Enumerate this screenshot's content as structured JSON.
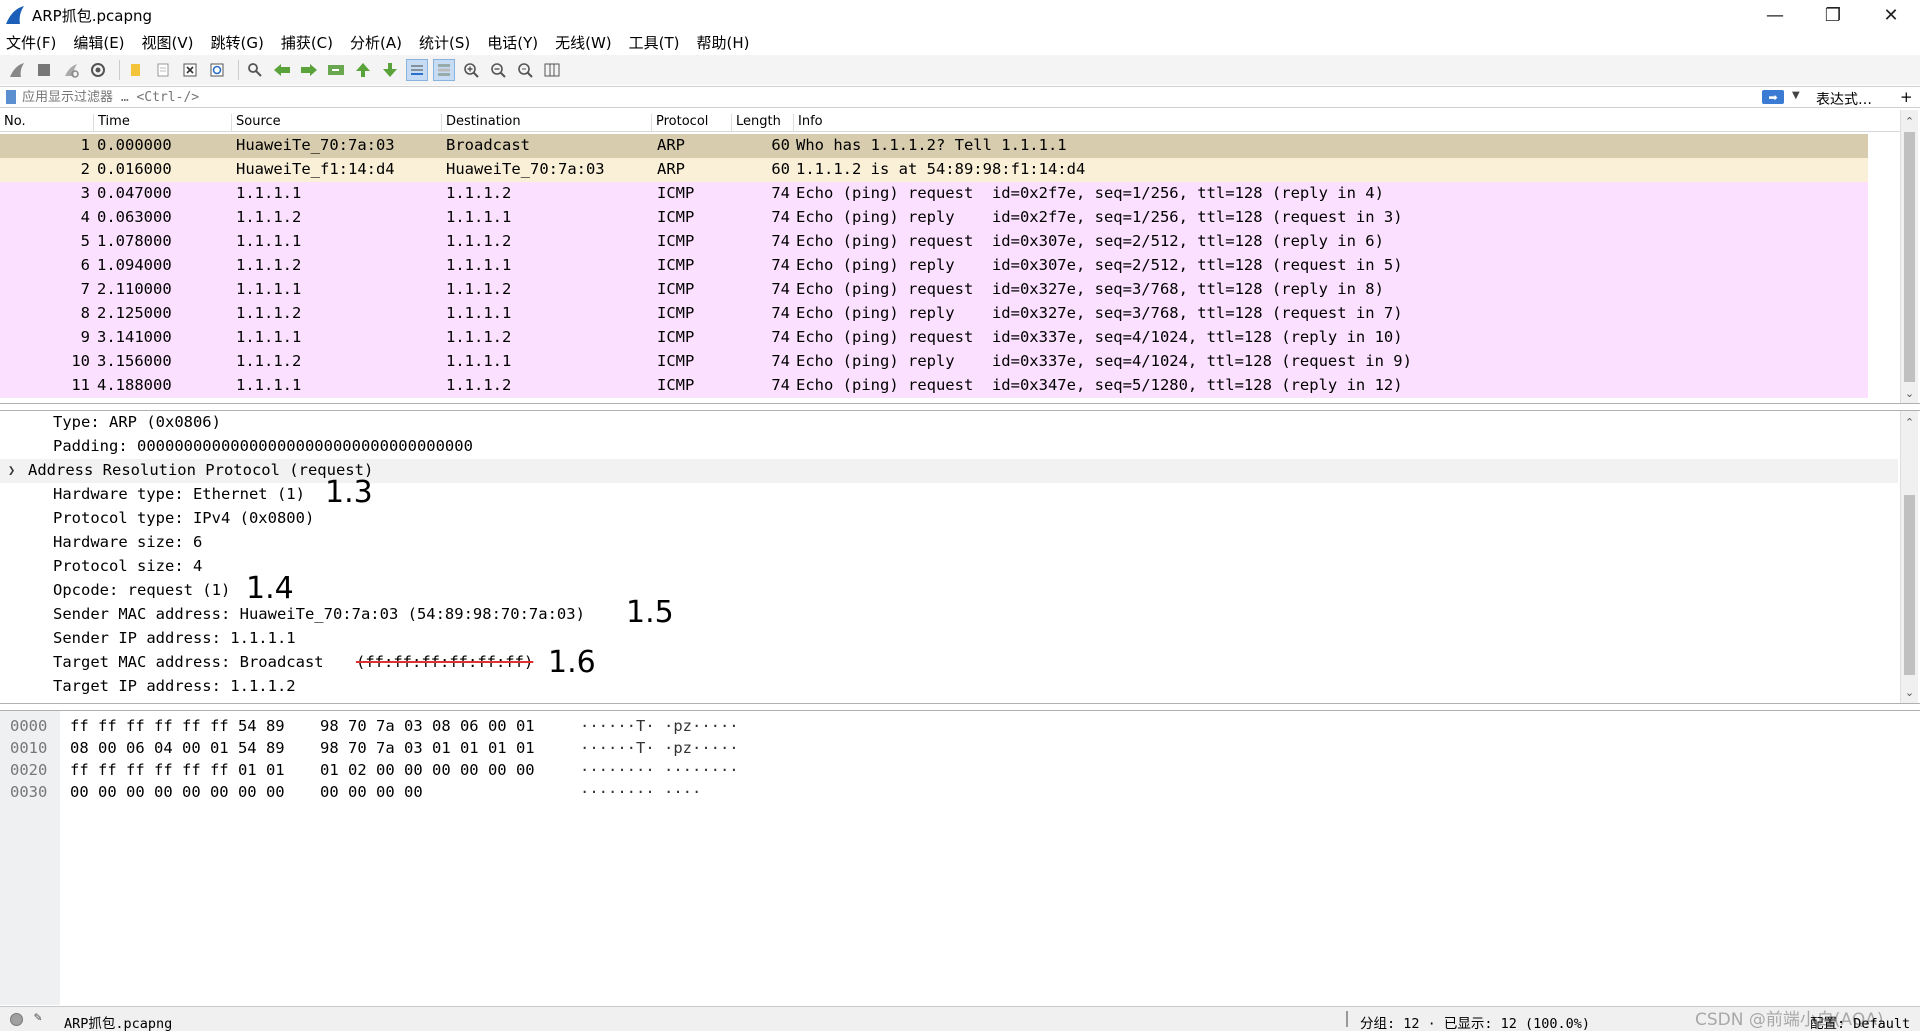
{
  "window": {
    "title": "ARP抓包.pcapng",
    "minimize": "—",
    "restore": "❐",
    "close": "✕"
  },
  "menu": [
    "文件(F)",
    "编辑(E)",
    "视图(V)",
    "跳转(G)",
    "捕获(C)",
    "分析(A)",
    "统计(S)",
    "电话(Y)",
    "无线(W)",
    "工具(T)",
    "帮助(H)"
  ],
  "toolbar": {
    "icons": [
      "shark-fin-start-icon",
      "stop-icon",
      "restart-icon",
      "options-gear-icon",
      "open-folder-icon",
      "save-file-icon",
      "close-file-icon",
      "reload-icon",
      "find-icon",
      "go-back-icon",
      "go-forward-icon",
      "go-to-packet-icon",
      "go-first-icon",
      "go-last-icon",
      "autoscroll-icon",
      "colorize-icon",
      "zoom-in-icon",
      "zoom-out-icon",
      "zoom-normal-icon",
      "resize-columns-icon"
    ]
  },
  "filter": {
    "placeholder": "应用显示过滤器 … <Ctrl-/>",
    "expression_label": "表达式…",
    "add_label": "+"
  },
  "packet_list": {
    "columns": [
      "No.",
      "Time",
      "Source",
      "Destination",
      "Protocol",
      "Length",
      "Info"
    ],
    "rows": [
      {
        "no": "1",
        "time": "0.000000",
        "src": "HuaweiTe_70:7a:03",
        "dst": "Broadcast",
        "proto": "ARP",
        "len": "60",
        "info": "Who has 1.1.1.2? Tell 1.1.1.1"
      },
      {
        "no": "2",
        "time": "0.016000",
        "src": "HuaweiTe_f1:14:d4",
        "dst": "HuaweiTe_70:7a:03",
        "proto": "ARP",
        "len": "60",
        "info": "1.1.1.2 is at 54:89:98:f1:14:d4"
      },
      {
        "no": "3",
        "time": "0.047000",
        "src": "1.1.1.1",
        "dst": "1.1.1.2",
        "proto": "ICMP",
        "len": "74",
        "info": "Echo (ping) request  id=0x2f7e, seq=1/256, ttl=128 (reply in 4)"
      },
      {
        "no": "4",
        "time": "0.063000",
        "src": "1.1.1.2",
        "dst": "1.1.1.1",
        "proto": "ICMP",
        "len": "74",
        "info": "Echo (ping) reply    id=0x2f7e, seq=1/256, ttl=128 (request in 3)"
      },
      {
        "no": "5",
        "time": "1.078000",
        "src": "1.1.1.1",
        "dst": "1.1.1.2",
        "proto": "ICMP",
        "len": "74",
        "info": "Echo (ping) request  id=0x307e, seq=2/512, ttl=128 (reply in 6)"
      },
      {
        "no": "6",
        "time": "1.094000",
        "src": "1.1.1.2",
        "dst": "1.1.1.1",
        "proto": "ICMP",
        "len": "74",
        "info": "Echo (ping) reply    id=0x307e, seq=2/512, ttl=128 (request in 5)"
      },
      {
        "no": "7",
        "time": "2.110000",
        "src": "1.1.1.1",
        "dst": "1.1.1.2",
        "proto": "ICMP",
        "len": "74",
        "info": "Echo (ping) request  id=0x327e, seq=3/768, ttl=128 (reply in 8)"
      },
      {
        "no": "8",
        "time": "2.125000",
        "src": "1.1.1.2",
        "dst": "1.1.1.1",
        "proto": "ICMP",
        "len": "74",
        "info": "Echo (ping) reply    id=0x327e, seq=3/768, ttl=128 (request in 7)"
      },
      {
        "no": "9",
        "time": "3.141000",
        "src": "1.1.1.1",
        "dst": "1.1.1.2",
        "proto": "ICMP",
        "len": "74",
        "info": "Echo (ping) request  id=0x337e, seq=4/1024, ttl=128 (reply in 10)"
      },
      {
        "no": "10",
        "time": "3.156000",
        "src": "1.1.1.2",
        "dst": "1.1.1.1",
        "proto": "ICMP",
        "len": "74",
        "info": "Echo (ping) reply    id=0x337e, seq=4/1024, ttl=128 (request in 9)"
      },
      {
        "no": "11",
        "time": "4.188000",
        "src": "1.1.1.1",
        "dst": "1.1.1.2",
        "proto": "ICMP",
        "len": "74",
        "info": "Echo (ping) request  id=0x347e, seq=5/1280, ttl=128 (reply in 12)"
      }
    ]
  },
  "details": {
    "lines": [
      "Type: ARP (0x0806)",
      "Padding: 000000000000000000000000000000000000",
      "Address Resolution Protocol (request)",
      "Hardware type: Ethernet (1)",
      "Protocol type: IPv4 (0x0800)",
      "Hardware size: 6",
      "Protocol size: 4",
      "Opcode: request (1)",
      "Sender MAC address: HuaweiTe_70:7a:03 (54:89:98:70:7a:03)",
      "Sender IP address: 1.1.1.1",
      "Target MAC address: Broadcast ",
      "Target IP address: 1.1.1.2"
    ],
    "target_mac_struck": "(ff:ff:ff:ff:ff:ff)",
    "annotations": [
      "1.3",
      "1.4",
      "1.5",
      "1.6"
    ]
  },
  "bytes": {
    "lines": [
      {
        "off": "0000",
        "hex1": "ff ff ff ff ff ff 54 89",
        "hex2": "98 70 7a 03 08 06 00 01",
        "asc": "······T· ·pz·····"
      },
      {
        "off": "0010",
        "hex1": "08 00 06 04 00 01 54 89",
        "hex2": "98 70 7a 03 01 01 01 01",
        "asc": "······T· ·pz·····"
      },
      {
        "off": "0020",
        "hex1": "ff ff ff ff ff ff 01 01",
        "hex2": "01 02 00 00 00 00 00 00",
        "asc": "········ ········"
      },
      {
        "off": "0030",
        "hex1": "00 00 00 00 00 00 00 00",
        "hex2": "00 00 00 00",
        "asc": "········ ····"
      }
    ]
  },
  "status": {
    "file": "ARP抓包.pcapng",
    "counts": "分组: 12 · 已显示: 12 (100.0%)",
    "profile": "配置: Default",
    "watermark": "CSDN @前端小白(AQA)"
  },
  "colors": {
    "selected_row": "#d7ccae",
    "arp_row": "#faf0d7",
    "icmp_row": "#fce0ff",
    "accent": "#3b7bd4"
  }
}
